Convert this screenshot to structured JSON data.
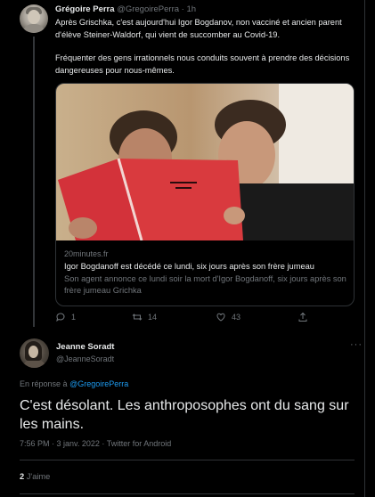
{
  "tweet1": {
    "display_name": "Grégoire Perra",
    "handle": "@GregoirePerra",
    "time": "1h",
    "paragraph1": "Après Grischka, c'est aujourd'hui Igor Bogdanov, non vacciné et ancien parent d'élève Steiner-Waldorf, qui vient de succomber au Covid-19.",
    "paragraph2": "Fréquenter des gens irrationnels nous conduits souvent à prendre des décisions dangereuses pour nous-mêmes.",
    "card": {
      "domain": "20minutes.fr",
      "title": "Igor Bogdanoff est décédé ce lundi, six jours après son frère jumeau",
      "description": "Son agent annonce ce lundi soir la mort d'Igor Bogdanoff, six jours après son frère jumeau Grichka"
    },
    "actions": {
      "reply_count": "1",
      "retweet_count": "14",
      "like_count": "43",
      "reply_icon": "reply-icon",
      "retweet_icon": "retweet-icon",
      "like_icon": "heart-icon",
      "share_icon": "share-icon"
    }
  },
  "tweet2": {
    "display_name": "Jeanne Soradt",
    "handle": "@JeanneSoradt",
    "more_label": "···",
    "reply_prefix": "En réponse à",
    "reply_to": "@GregoirePerra",
    "text": "C'est désolant. Les anthroposophes ont du sang sur les mains.",
    "meta": "7:56 PM · 3 janv. 2022 · Twitter for Android",
    "likes_count": "2",
    "likes_label": "J'aime"
  },
  "colors": {
    "background": "#000000",
    "text": "#e7e9ea",
    "secondary": "#71767b",
    "link": "#1d9bf0",
    "border": "#2f3336"
  }
}
